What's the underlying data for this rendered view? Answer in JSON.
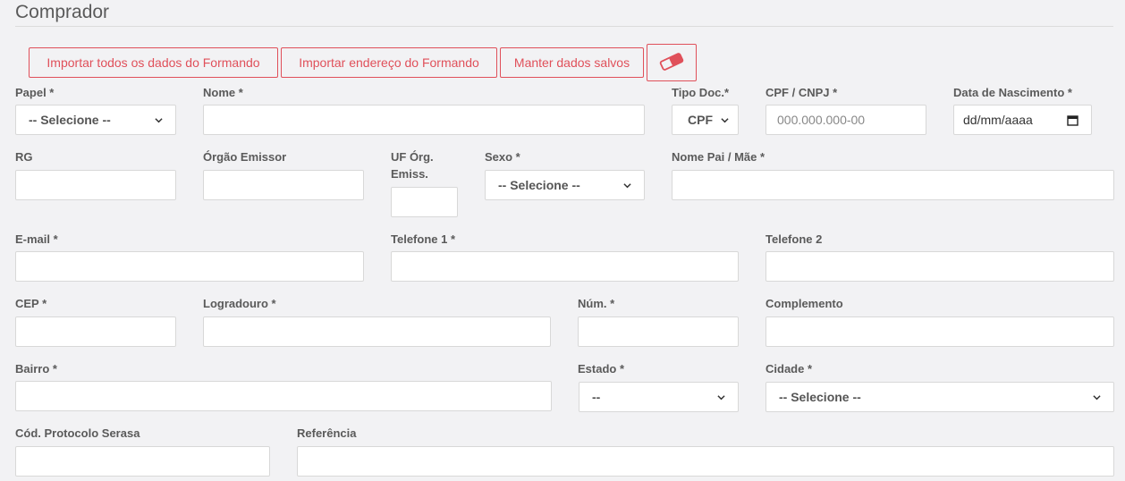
{
  "section": {
    "title": "Comprador"
  },
  "buttons": {
    "import_all": "Importar todos os dados do Formando",
    "import_address": "Importar endereço do Formando",
    "keep_saved": "Manter dados salvos"
  },
  "fields": {
    "papel": {
      "label": "Papel *",
      "value": "-- Selecione --"
    },
    "nome": {
      "label": "Nome *",
      "value": ""
    },
    "tipo_doc": {
      "label": "Tipo Doc.*",
      "value": "CPF"
    },
    "cpf": {
      "label": "CPF / CNPJ *",
      "placeholder": "000.000.000-00"
    },
    "nascimento": {
      "label": "Data de Nascimento *",
      "placeholder": "dd/mm/aaaa"
    },
    "rg": {
      "label": "RG"
    },
    "orgao": {
      "label": "Órgão Emissor"
    },
    "uf_line1": "UF Órg.",
    "uf_line2": "Emiss.",
    "sexo": {
      "label": "Sexo *",
      "value": "-- Selecione --"
    },
    "nome_pai": {
      "label": "Nome Pai / Mãe *"
    },
    "email": {
      "label": "E-mail *"
    },
    "telefone1": {
      "label": "Telefone 1 *"
    },
    "telefone2": {
      "label": "Telefone 2"
    },
    "cep": {
      "label": "CEP *"
    },
    "logradouro": {
      "label": "Logradouro *"
    },
    "num": {
      "label": "Núm. *"
    },
    "complemento": {
      "label": "Complemento"
    },
    "bairro": {
      "label": "Bairro *"
    },
    "estado": {
      "label": "Estado *",
      "value": "--"
    },
    "cidade": {
      "label": "Cidade *",
      "value": "-- Selecione --"
    },
    "protocolo": {
      "label": "Cód. Protocolo Serasa"
    },
    "referencia": {
      "label": "Referência"
    }
  },
  "colors": {
    "accent": "#e0505a",
    "background": "#f2f2f4"
  },
  "icons": {
    "eraser": "eraser-icon",
    "calendar": "calendar-icon",
    "dropdown": "chevron-down-icon"
  }
}
